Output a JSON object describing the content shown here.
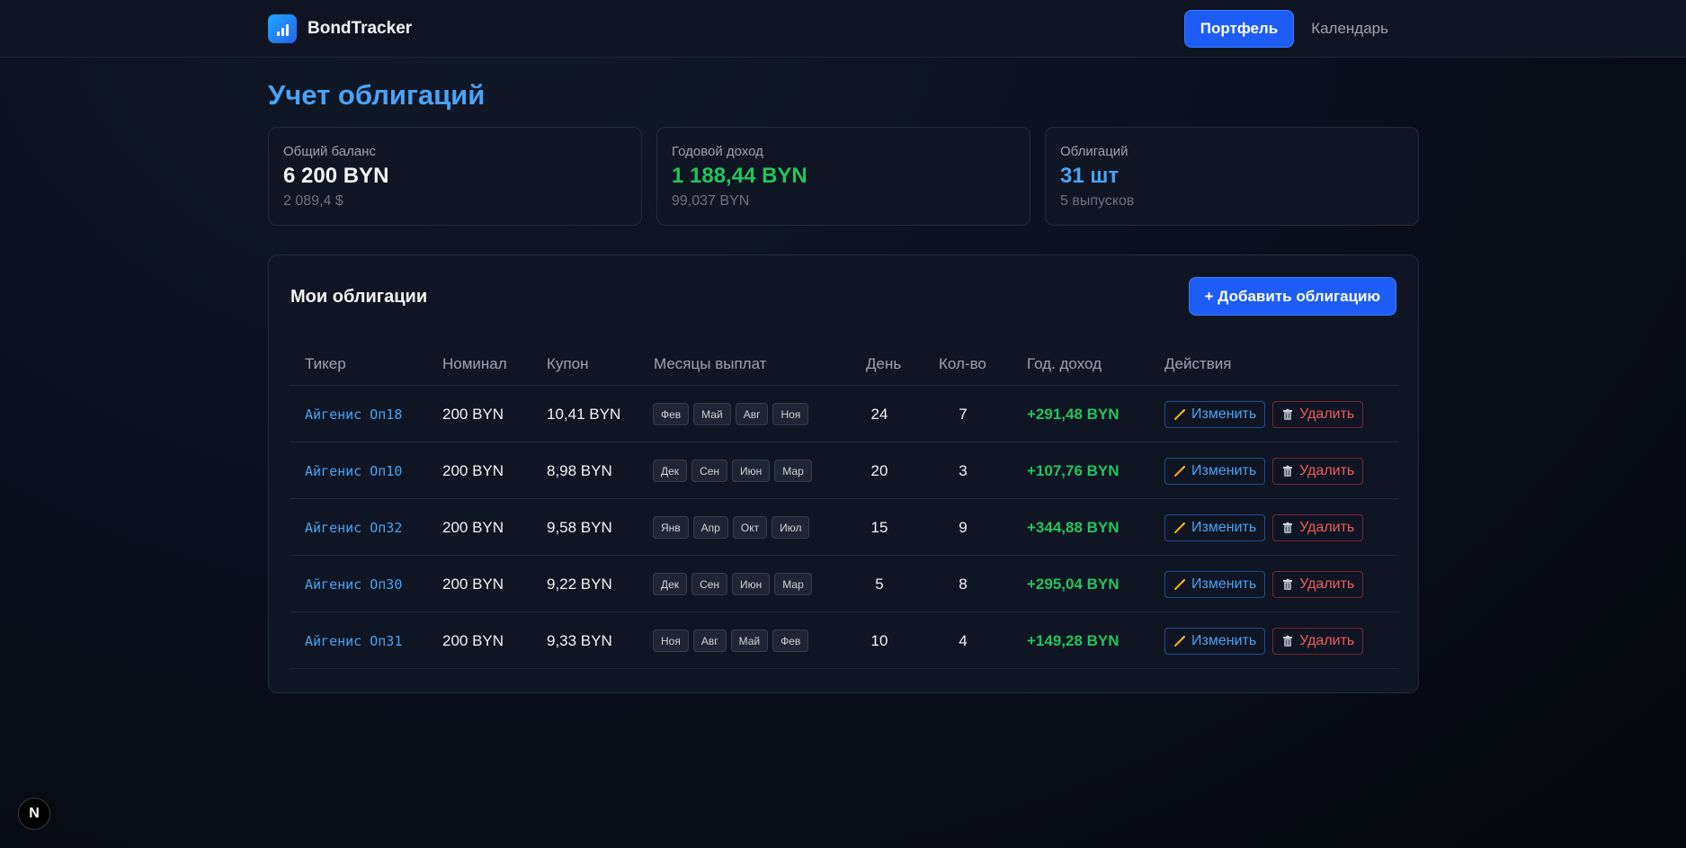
{
  "app": {
    "name": "BondTracker",
    "nav": {
      "portfolio": "Портфель",
      "calendar": "Календарь"
    },
    "framework_badge": "N"
  },
  "page": {
    "title": "Учет облигаций"
  },
  "stats": [
    {
      "label": "Общий баланс",
      "value": "6 200 BYN",
      "sub": "2 089,4 $",
      "color": "#f3f4f6"
    },
    {
      "label": "Годовой доход",
      "value": "1 188,44 BYN",
      "sub": "99,037 BYN",
      "color": "#22c55e"
    },
    {
      "label": "Облигаций",
      "value": "31 шт",
      "sub": "5 выпусков",
      "color": "#4aa3f5"
    }
  ],
  "bonds_panel": {
    "title": "Мои облигации",
    "add_button": "+ Добавить облигацию",
    "columns": [
      "Тикер",
      "Номинал",
      "Купон",
      "Месяцы выплат",
      "День",
      "Кол-во",
      "Год. доход",
      "Действия"
    ],
    "edit_label": "Изменить",
    "delete_label": "Удалить",
    "rows": [
      {
        "ticker": "Айгенис Оп18",
        "nominal": "200 BYN",
        "coupon": "10,41 BYN",
        "months": [
          "Фев",
          "Май",
          "Авг",
          "Ноя"
        ],
        "day": "24",
        "qty": "7",
        "income": "+291,48 BYN"
      },
      {
        "ticker": "Айгенис Оп10",
        "nominal": "200 BYN",
        "coupon": "8,98 BYN",
        "months": [
          "Дек",
          "Сен",
          "Июн",
          "Мар"
        ],
        "day": "20",
        "qty": "3",
        "income": "+107,76 BYN"
      },
      {
        "ticker": "Айгенис Оп32",
        "nominal": "200 BYN",
        "coupon": "9,58 BYN",
        "months": [
          "Янв",
          "Апр",
          "Окт",
          "Июл"
        ],
        "day": "15",
        "qty": "9",
        "income": "+344,88 BYN"
      },
      {
        "ticker": "Айгенис Оп30",
        "nominal": "200 BYN",
        "coupon": "9,22 BYN",
        "months": [
          "Дек",
          "Сен",
          "Июн",
          "Мар"
        ],
        "day": "5",
        "qty": "8",
        "income": "+295,04 BYN"
      },
      {
        "ticker": "Айгенис Оп31",
        "nominal": "200 BYN",
        "coupon": "9,33 BYN",
        "months": [
          "Ноя",
          "Авг",
          "Май",
          "Фев"
        ],
        "day": "10",
        "qty": "4",
        "income": "+149,28 BYN"
      }
    ]
  }
}
